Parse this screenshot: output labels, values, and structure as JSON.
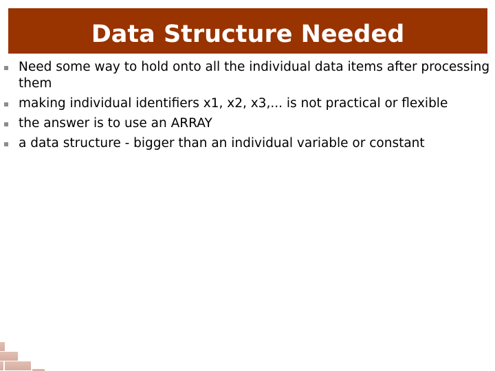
{
  "slide": {
    "title": "Data Structure Needed",
    "accent_color": "#993300",
    "bullets": [
      "Need some way to hold onto all the individual data items after processing them",
      "making individual identifiers x1, x2, x3,... is not practical or flexible",
      "the answer is to use an ARRAY",
      "a data structure - bigger than an individual variable or constant"
    ]
  }
}
